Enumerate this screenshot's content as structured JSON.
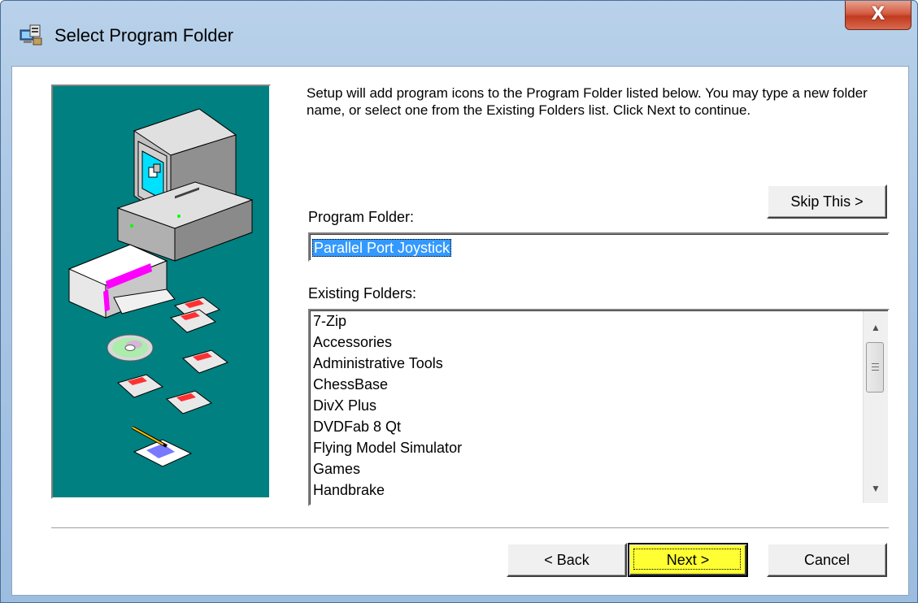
{
  "window": {
    "title": "Select Program Folder",
    "close_label": "X"
  },
  "description": "Setup will add program icons to the Program Folder listed below. You may type a new folder name, or select one from the Existing Folders list. Click Next to continue.",
  "skip_button": "Skip This >",
  "program_folder": {
    "label": "Program Folder:",
    "value": "Parallel Port Joystick"
  },
  "existing_folders": {
    "label": "Existing Folders:",
    "items": [
      "7-Zip",
      "Accessories",
      "Administrative Tools",
      "ChessBase",
      "DivX Plus",
      "DVDFab 8 Qt",
      "Flying Model Simulator",
      "Games",
      "Handbrake"
    ]
  },
  "buttons": {
    "back": "< Back",
    "next": "Next >",
    "cancel": "Cancel"
  },
  "colors": {
    "sidebar_bg": "#008080",
    "highlight": "#ffff33",
    "selection": "#3399ff"
  }
}
